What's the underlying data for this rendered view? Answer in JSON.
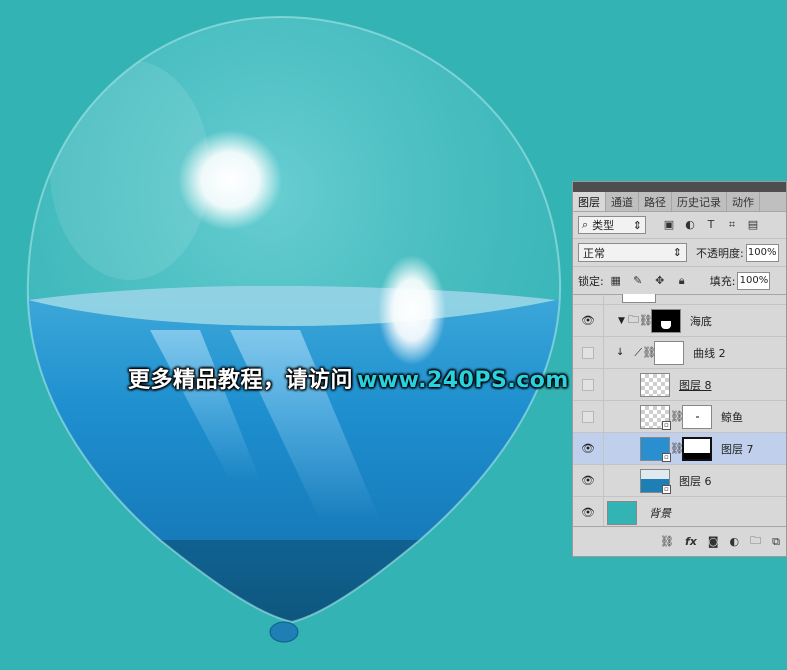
{
  "watermark": {
    "text": "更多精品教程，请访问",
    "url": "www.240PS.com"
  },
  "layers_panel": {
    "tabs": [
      "图层",
      "通道",
      "路径",
      "历史记录",
      "动作"
    ],
    "filter": {
      "value": "类型"
    },
    "blend_mode": "正常",
    "opacity_label": "不透明度:",
    "opacity_value": "100%",
    "lock_label": "锁定:",
    "fill_label": "填充:",
    "fill_value": "100%",
    "layers": [
      {
        "name": "海底",
        "visible": true,
        "type": "group"
      },
      {
        "name": "曲线 2",
        "visible": false,
        "type": "adjustment"
      },
      {
        "name": "图层 8",
        "visible": false,
        "type": "pixel"
      },
      {
        "name": "鲸鱼",
        "visible": false,
        "type": "smart-masked"
      },
      {
        "name": "图层 7",
        "visible": true,
        "type": "smart-masked",
        "selected": true
      },
      {
        "name": "图层 6",
        "visible": true,
        "type": "smart"
      },
      {
        "name": "背景",
        "visible": true,
        "type": "background"
      }
    ],
    "footer_icons": [
      "link-icon",
      "fx-icon",
      "mask-icon",
      "adjustment-icon",
      "folder-icon",
      "new-layer-icon"
    ],
    "footer_fx": "fx"
  },
  "colors": {
    "background": "#34b3b5",
    "selection": "#c0cfeb"
  }
}
